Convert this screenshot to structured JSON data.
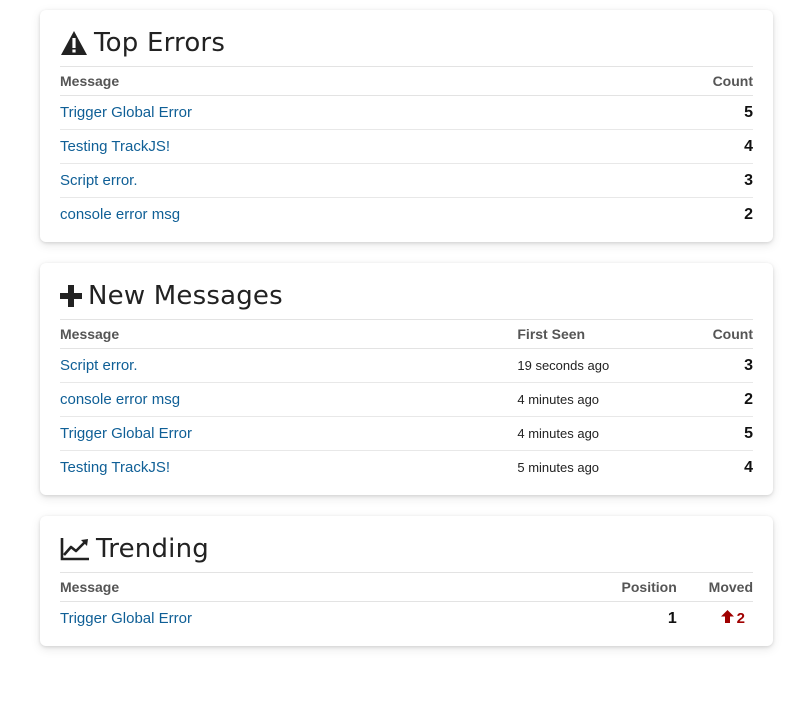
{
  "top_errors": {
    "title": "Top Errors",
    "icon": "warning-icon",
    "columns": {
      "message": "Message",
      "count": "Count"
    },
    "rows": [
      {
        "message": "Trigger Global Error",
        "count": "5"
      },
      {
        "message": "Testing TrackJS!",
        "count": "4"
      },
      {
        "message": "Script error.",
        "count": "3"
      },
      {
        "message": "console error msg",
        "count": "2"
      }
    ]
  },
  "new_messages": {
    "title": "New Messages",
    "icon": "plus-icon",
    "columns": {
      "message": "Message",
      "first_seen": "First Seen",
      "count": "Count"
    },
    "rows": [
      {
        "message": "Script error.",
        "first_seen": "19 seconds ago",
        "count": "3"
      },
      {
        "message": "console error msg",
        "first_seen": "4 minutes ago",
        "count": "2"
      },
      {
        "message": "Trigger Global Error",
        "first_seen": "4 minutes ago",
        "count": "5"
      },
      {
        "message": "Testing TrackJS!",
        "first_seen": "5 minutes ago",
        "count": "4"
      }
    ]
  },
  "trending": {
    "title": "Trending",
    "icon": "line-chart-icon",
    "columns": {
      "message": "Message",
      "position": "Position",
      "moved": "Moved"
    },
    "rows": [
      {
        "message": "Trigger Global Error",
        "position": "1",
        "moved": "2",
        "moved_icon": "arrow-up-icon"
      }
    ]
  },
  "colors": {
    "link": "#0f5f96",
    "moved_up": "#a00000"
  }
}
